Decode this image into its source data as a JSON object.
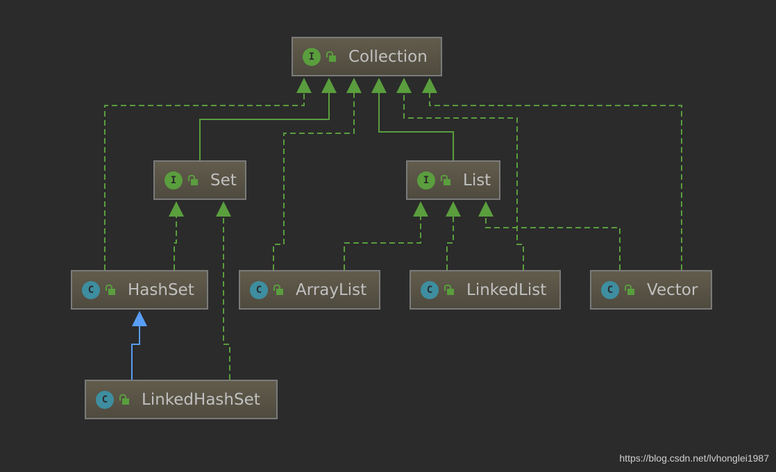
{
  "diagram": {
    "nodes": [
      {
        "id": "collection",
        "name": "Collection",
        "kind": "interface",
        "badge": "I"
      },
      {
        "id": "set",
        "name": "Set",
        "kind": "interface",
        "badge": "I"
      },
      {
        "id": "list",
        "name": "List",
        "kind": "interface",
        "badge": "I"
      },
      {
        "id": "hashset",
        "name": "HashSet",
        "kind": "class",
        "badge": "C"
      },
      {
        "id": "arraylist",
        "name": "ArrayList",
        "kind": "class",
        "badge": "C"
      },
      {
        "id": "linkedlist",
        "name": "LinkedList",
        "kind": "class",
        "badge": "C"
      },
      {
        "id": "vector",
        "name": "Vector",
        "kind": "class",
        "badge": "C"
      },
      {
        "id": "linkedhashset",
        "name": "LinkedHashSet",
        "kind": "class",
        "badge": "C"
      }
    ],
    "edges": [
      {
        "from": "hashset",
        "to": "collection",
        "type": "implements"
      },
      {
        "from": "set",
        "to": "collection",
        "type": "extends-interface"
      },
      {
        "from": "arraylist",
        "to": "collection",
        "type": "implements"
      },
      {
        "from": "list",
        "to": "collection",
        "type": "extends-interface"
      },
      {
        "from": "linkedlist",
        "to": "collection",
        "type": "implements"
      },
      {
        "from": "vector",
        "to": "collection",
        "type": "implements"
      },
      {
        "from": "hashset",
        "to": "set",
        "type": "implements"
      },
      {
        "from": "linkedhashset",
        "to": "set",
        "type": "implements"
      },
      {
        "from": "arraylist",
        "to": "list",
        "type": "implements"
      },
      {
        "from": "linkedlist",
        "to": "list",
        "type": "implements"
      },
      {
        "from": "vector",
        "to": "list",
        "type": "implements"
      },
      {
        "from": "linkedhashset",
        "to": "hashset",
        "type": "extends"
      }
    ]
  },
  "colors": {
    "background": "#2b2b2b",
    "interface_badge": "#5a9e3e",
    "class_badge": "#3e8ea0",
    "implements_edge": "#5a9e3e",
    "extends_edge": "#589df6"
  },
  "watermark": "https://blog.csdn.net/lvhonglei1987"
}
